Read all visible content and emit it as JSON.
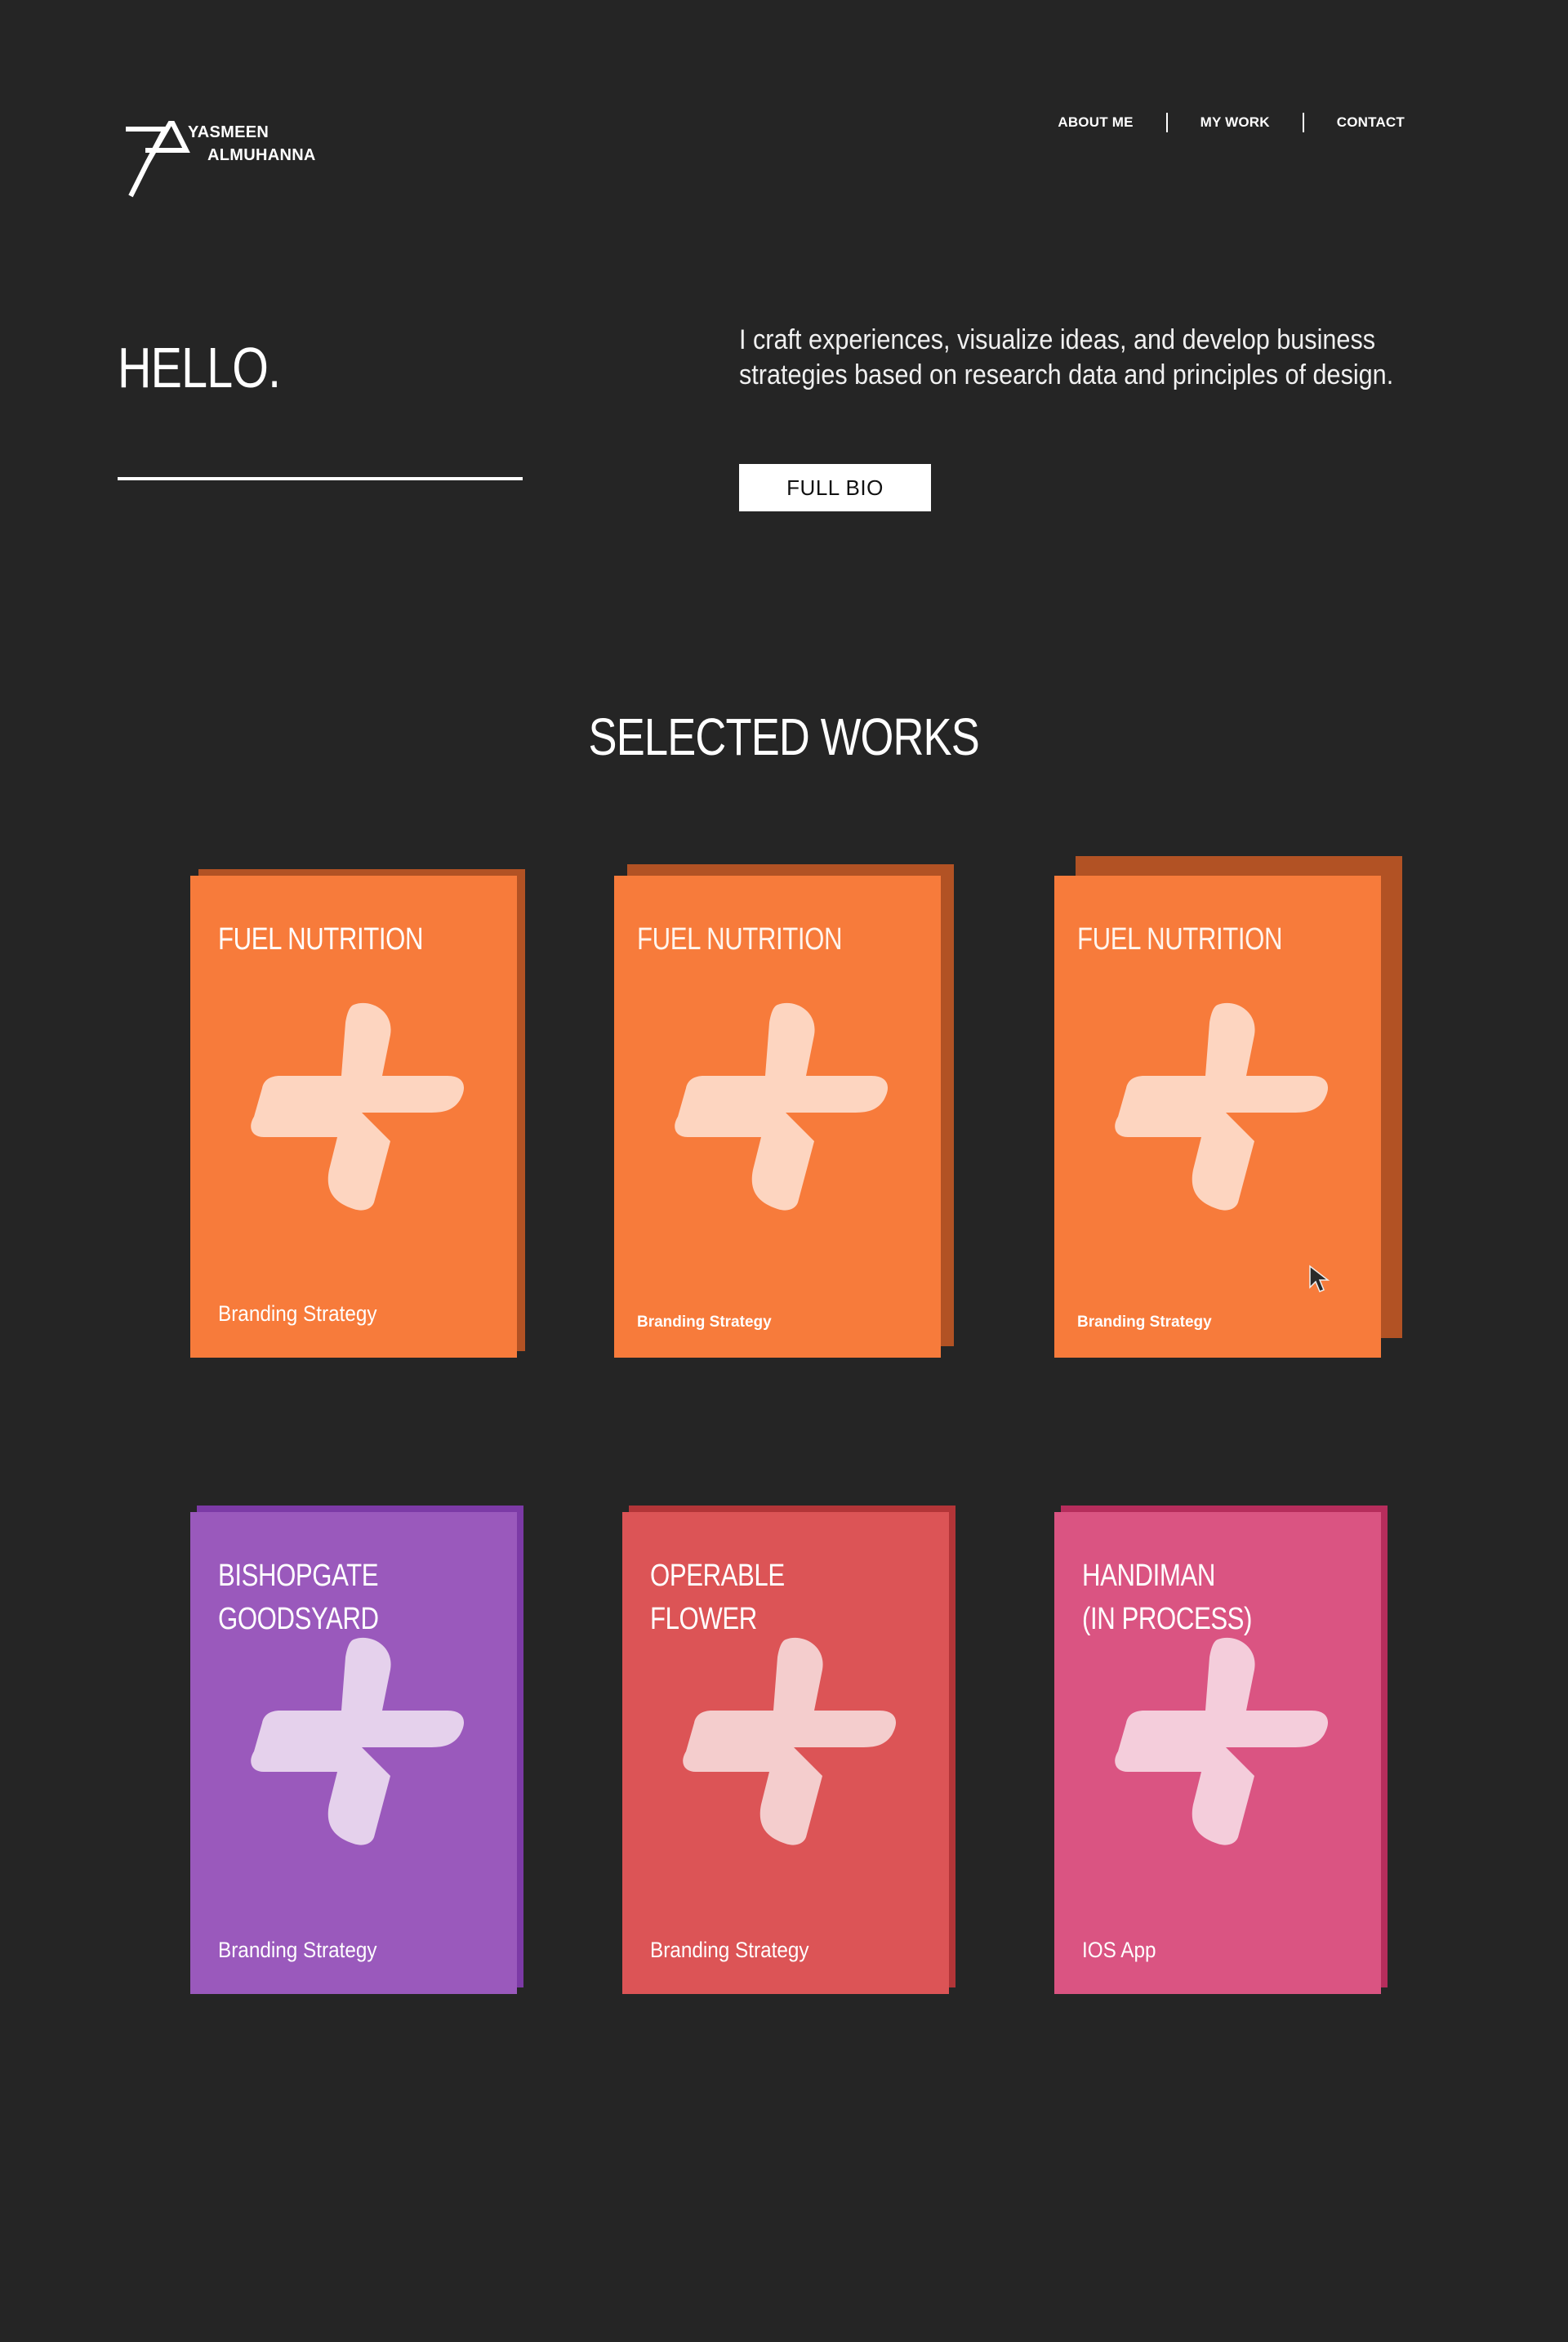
{
  "header": {
    "logo_line1": "YASMEEN",
    "logo_line2": "ALMUHANNA",
    "nav": [
      {
        "label": "ABOUT ME"
      },
      {
        "label": "MY WORK"
      },
      {
        "label": "CONTACT"
      }
    ]
  },
  "hero": {
    "greeting": "HELLO.",
    "tagline": "I craft experiences, visualize ideas, and develop business strategies based on research data and principles of design.",
    "bio_button": "FULL BIO"
  },
  "works": {
    "title": "SELECTED WORKS",
    "cards": [
      {
        "title": "FUEL NUTRITION",
        "category": "Branding Strategy",
        "color": "#f77b3b",
        "shadow": "#b25224",
        "icon": "plus-shape-icon",
        "icon_color": "#fdd5c0"
      },
      {
        "title": "FUEL NUTRITION",
        "category": "Branding Strategy",
        "color": "#f77b3b",
        "shadow": "#b25224",
        "icon": "plus-shape-icon",
        "icon_color": "#fdd5c0"
      },
      {
        "title": "FUEL NUTRITION",
        "category": "Branding Strategy",
        "color": "#f77b3b",
        "shadow": "#b25224",
        "icon": "plus-shape-icon",
        "icon_color": "#fdd5c0"
      },
      {
        "title": "BISHOPGATE\nGOODSYARD",
        "category": "Branding Strategy",
        "color": "#9a59bc",
        "shadow": "#7c3aa6",
        "icon": "plus-shape-icon",
        "icon_color": "#e5d1ec"
      },
      {
        "title": "OPERABLE FLOWER",
        "category": "Branding Strategy",
        "color": "#dc5456",
        "shadow": "#b33538",
        "icon": "plus-shape-icon",
        "icon_color": "#f4cdcd"
      },
      {
        "title": "HANDIMAN\n(IN PROCESS)",
        "category": "IOS App",
        "color": "#da5482",
        "shadow": "#b62d5c",
        "icon": "plus-shape-icon",
        "icon_color": "#f4cddb"
      }
    ]
  }
}
